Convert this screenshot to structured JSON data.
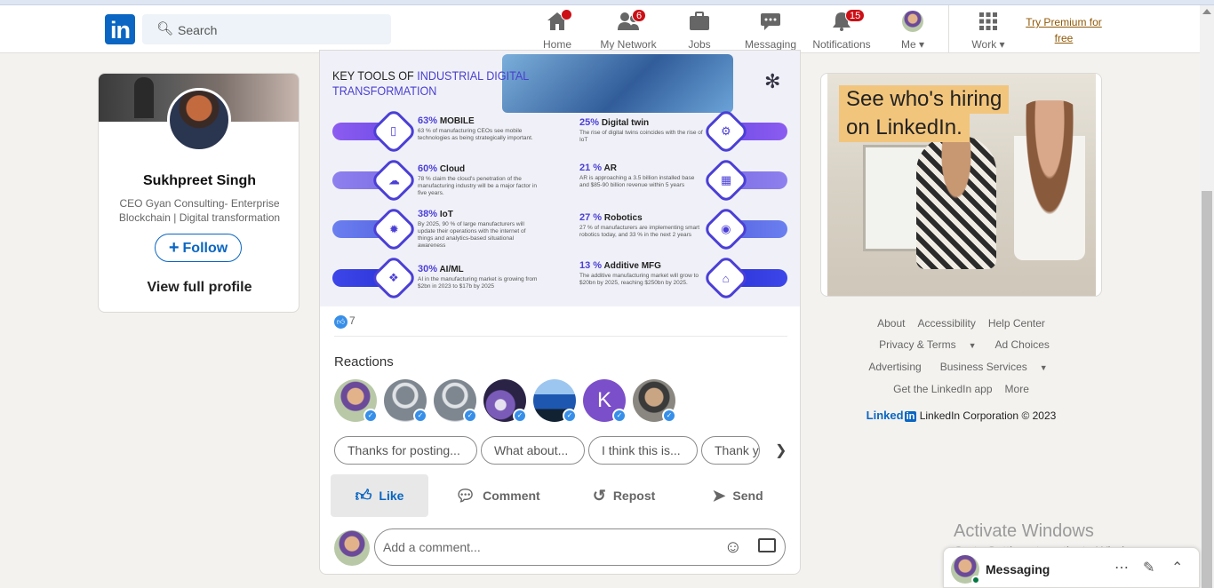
{
  "nav": {
    "logo": "in",
    "search_placeholder": "Search",
    "items": [
      {
        "label": "Home",
        "badge": ""
      },
      {
        "label": "My Network",
        "badge": "6"
      },
      {
        "label": "Jobs",
        "badge": ""
      },
      {
        "label": "Messaging",
        "badge": ""
      },
      {
        "label": "Notifications",
        "badge": "15"
      },
      {
        "label": "Me",
        "badge": ""
      },
      {
        "label": "Work",
        "badge": ""
      }
    ],
    "premium": "Try Premium for free"
  },
  "profile": {
    "name": "Sukhpreet Singh",
    "headline": "CEO Gyan Consulting- Enterprise Blockchain | Digital transformation",
    "follow_label": "Follow",
    "follow_plus": "+",
    "view_profile": "View full profile"
  },
  "post": {
    "infographic": {
      "title_line1_plain": "KEY TOOLS OF ",
      "title_line1_hl": "INDUSTRIAL DIGITAL",
      "title_line2_hl": "TRANSFORMATION",
      "left_items": [
        {
          "pct": "63%",
          "name": "MOBILE",
          "desc": "63 % of manufacturing CEOs see mobile technologies as being strategically important."
        },
        {
          "pct": "60%",
          "name": "Cloud",
          "desc": "78 % claim the cloud's penetration of the manufacturing industry will be a major factor in five years."
        },
        {
          "pct": "38%",
          "name": "IoT",
          "desc": "By 2025, 90 % of large manufacturers will update their operations with the internet of things and analytics-based situational awareness"
        },
        {
          "pct": "30%",
          "name": "AI/ML",
          "desc": "AI in the manufacturing market is growing from $2bn in 2023 to $17b by 2025"
        }
      ],
      "right_items": [
        {
          "pct": "25%",
          "name": "Digital twin",
          "desc": "The rise of digital twins coincides with the rise of IoT"
        },
        {
          "pct": "21 %",
          "name": "AR",
          "desc": "AR is approaching a 3.5 billion installed base and $85-90 billion revenue within 5 years"
        },
        {
          "pct": "27 %",
          "name": "Robotics",
          "desc": "27 % of manufacturers are implementing smart robotics today, and 33 % in the next 2 years"
        },
        {
          "pct": "13 %",
          "name": "Additive MFG",
          "desc": "The additive manufacturing market will grow to $20bn by 2025, reaching $250bn by 2025."
        }
      ]
    },
    "reaction_count": "7",
    "reactions_heading": "Reactions",
    "reactors": [
      {
        "initial": "",
        "color": "#b9c9a8"
      },
      {
        "initial": "",
        "color": "#c9ced3"
      },
      {
        "initial": "",
        "color": "#c9ced3"
      },
      {
        "initial": "",
        "color": "#3a2f5e"
      },
      {
        "initial": "",
        "color": "#1f4e8c"
      },
      {
        "initial": "K",
        "color": "#7b4fc9"
      },
      {
        "initial": "",
        "color": "#6d6a63"
      }
    ],
    "suggestions": [
      "Thanks for posting...",
      "What about...",
      "I think this is...",
      "Thank y"
    ],
    "actions": {
      "like": "Like",
      "comment": "Comment",
      "repost": "Repost",
      "send": "Send"
    },
    "comment_placeholder": "Add a comment..."
  },
  "ad": {
    "line1": "See who's hiring",
    "line2": "on LinkedIn."
  },
  "footer": {
    "row1": [
      "About",
      "Accessibility",
      "Help Center"
    ],
    "row2": [
      "Privacy & Terms",
      "Ad Choices"
    ],
    "row3": [
      "Advertising",
      "Business Services"
    ],
    "row4": [
      "Get the LinkedIn app",
      "More"
    ],
    "brand": "Linked",
    "brand_in": "in",
    "copyright": "LinkedIn Corporation © 2023"
  },
  "watermark": {
    "line1": "Activate Windows",
    "line2": "Go to Settings to activate Windows."
  },
  "messaging": {
    "title": "Messaging"
  },
  "colors": {
    "brand": "#0a66c2",
    "accent_purple": "#4b3fd6",
    "notification_red": "#cc1016"
  }
}
